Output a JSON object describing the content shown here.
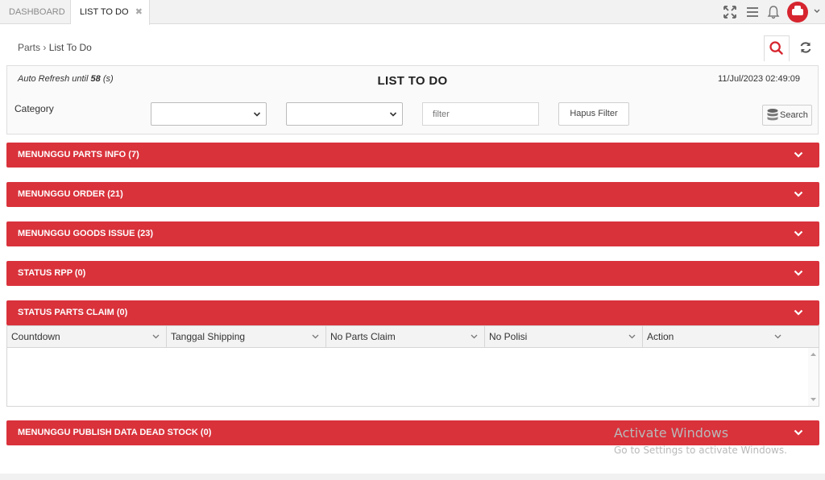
{
  "tabs": [
    {
      "label": "DASHBOARD"
    },
    {
      "label": "LIST TO DO",
      "close": "✖"
    }
  ],
  "breadcrumb": {
    "parent": "Parts",
    "current": "List To Do"
  },
  "header": {
    "auto_refresh_prefix": "Auto Refresh until",
    "auto_refresh_seconds": "58",
    "auto_refresh_suffix": "(s)",
    "title": "LIST TO DO",
    "datetime": "11/Jul/2023 02:49:09"
  },
  "filters": {
    "category_label": "Category",
    "category_select_value": "",
    "sub_select_value": "",
    "filter_placeholder": "filter",
    "clear_button": "Hapus Filter",
    "search_button": "Search"
  },
  "sections": [
    {
      "label": "MENUNGGU PARTS INFO (7)"
    },
    {
      "label": "MENUNGGU ORDER (21)"
    },
    {
      "label": "MENUNGGU GOODS ISSUE (23)"
    },
    {
      "label": "STATUS RPP (0)"
    },
    {
      "label": "STATUS PARTS CLAIM (0)"
    },
    {
      "label": "MENUNGGU PUBLISH DATA DEAD STOCK (0)"
    }
  ],
  "claim_grid": {
    "columns": [
      "Countdown",
      "Tanggal Shipping",
      "No Parts Claim",
      "No Polisi",
      "Action"
    ],
    "rows": []
  },
  "watermark": {
    "line1": "Activate Windows",
    "line2": "Go to Settings to activate Windows."
  },
  "colors": {
    "accent": "#d9323b",
    "brand": "#d6252f"
  },
  "icons": [
    "fullscreen-icon",
    "menu-icon",
    "bell-icon",
    "car-avatar-icon",
    "search-icon",
    "refresh-icon",
    "database-icon",
    "chevron-down-icon"
  ]
}
